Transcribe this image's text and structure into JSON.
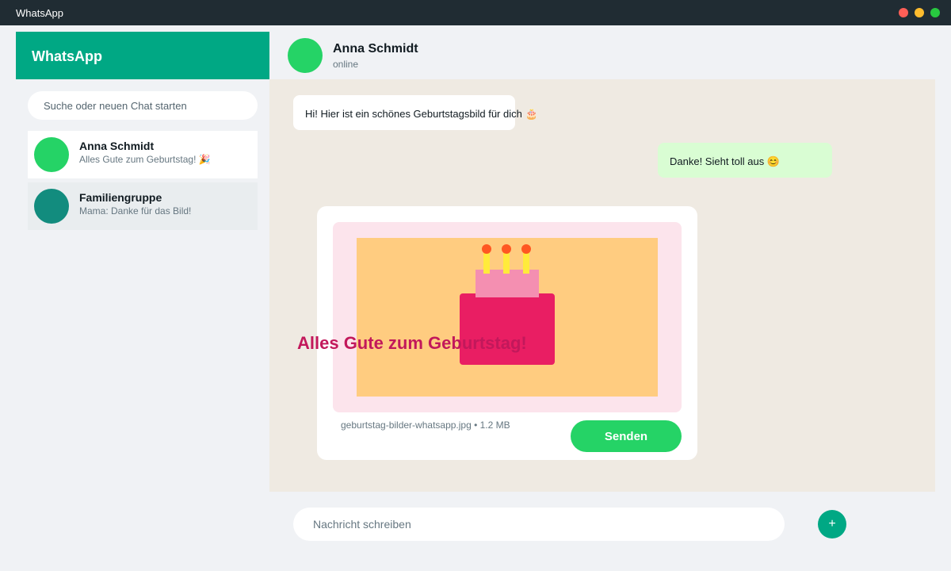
{
  "window": {
    "title": "WhatsApp"
  },
  "sidebar": {
    "brand": "WhatsApp",
    "search_placeholder": "Suche oder neuen Chat starten",
    "chats": [
      {
        "name": "Anna Schmidt",
        "preview": "Alles Gute zum Geburtstag! 🎉",
        "avatar_color": "#25d366",
        "selected": true
      },
      {
        "name": "Familiengruppe",
        "preview": "Mama: Danke für das Bild!",
        "avatar_color": "#128c7e",
        "selected": false
      }
    ]
  },
  "chat": {
    "contact_name": "Anna Schmidt",
    "status": "online",
    "messages": [
      {
        "direction": "incoming",
        "text": "Hi! Hier ist ein schönes Geburtstagsbild für dich 🎂"
      },
      {
        "direction": "outgoing",
        "text": "Danke! Sieht toll aus 😊"
      }
    ],
    "attachment": {
      "caption": "Alles Gute zum Geburtstag!",
      "file_info": "geburtstag-bilder-whatsapp.jpg • 1.2 MB",
      "send_label": "Senden"
    }
  },
  "composer": {
    "placeholder": "Nachricht schreiben",
    "add_label": "+"
  },
  "colors": {
    "brand": "#00a884",
    "titlebar": "#202c33",
    "chat_background": "#efeae2",
    "outgoing_bubble": "#d9fdd3",
    "send_button": "#25d366"
  }
}
